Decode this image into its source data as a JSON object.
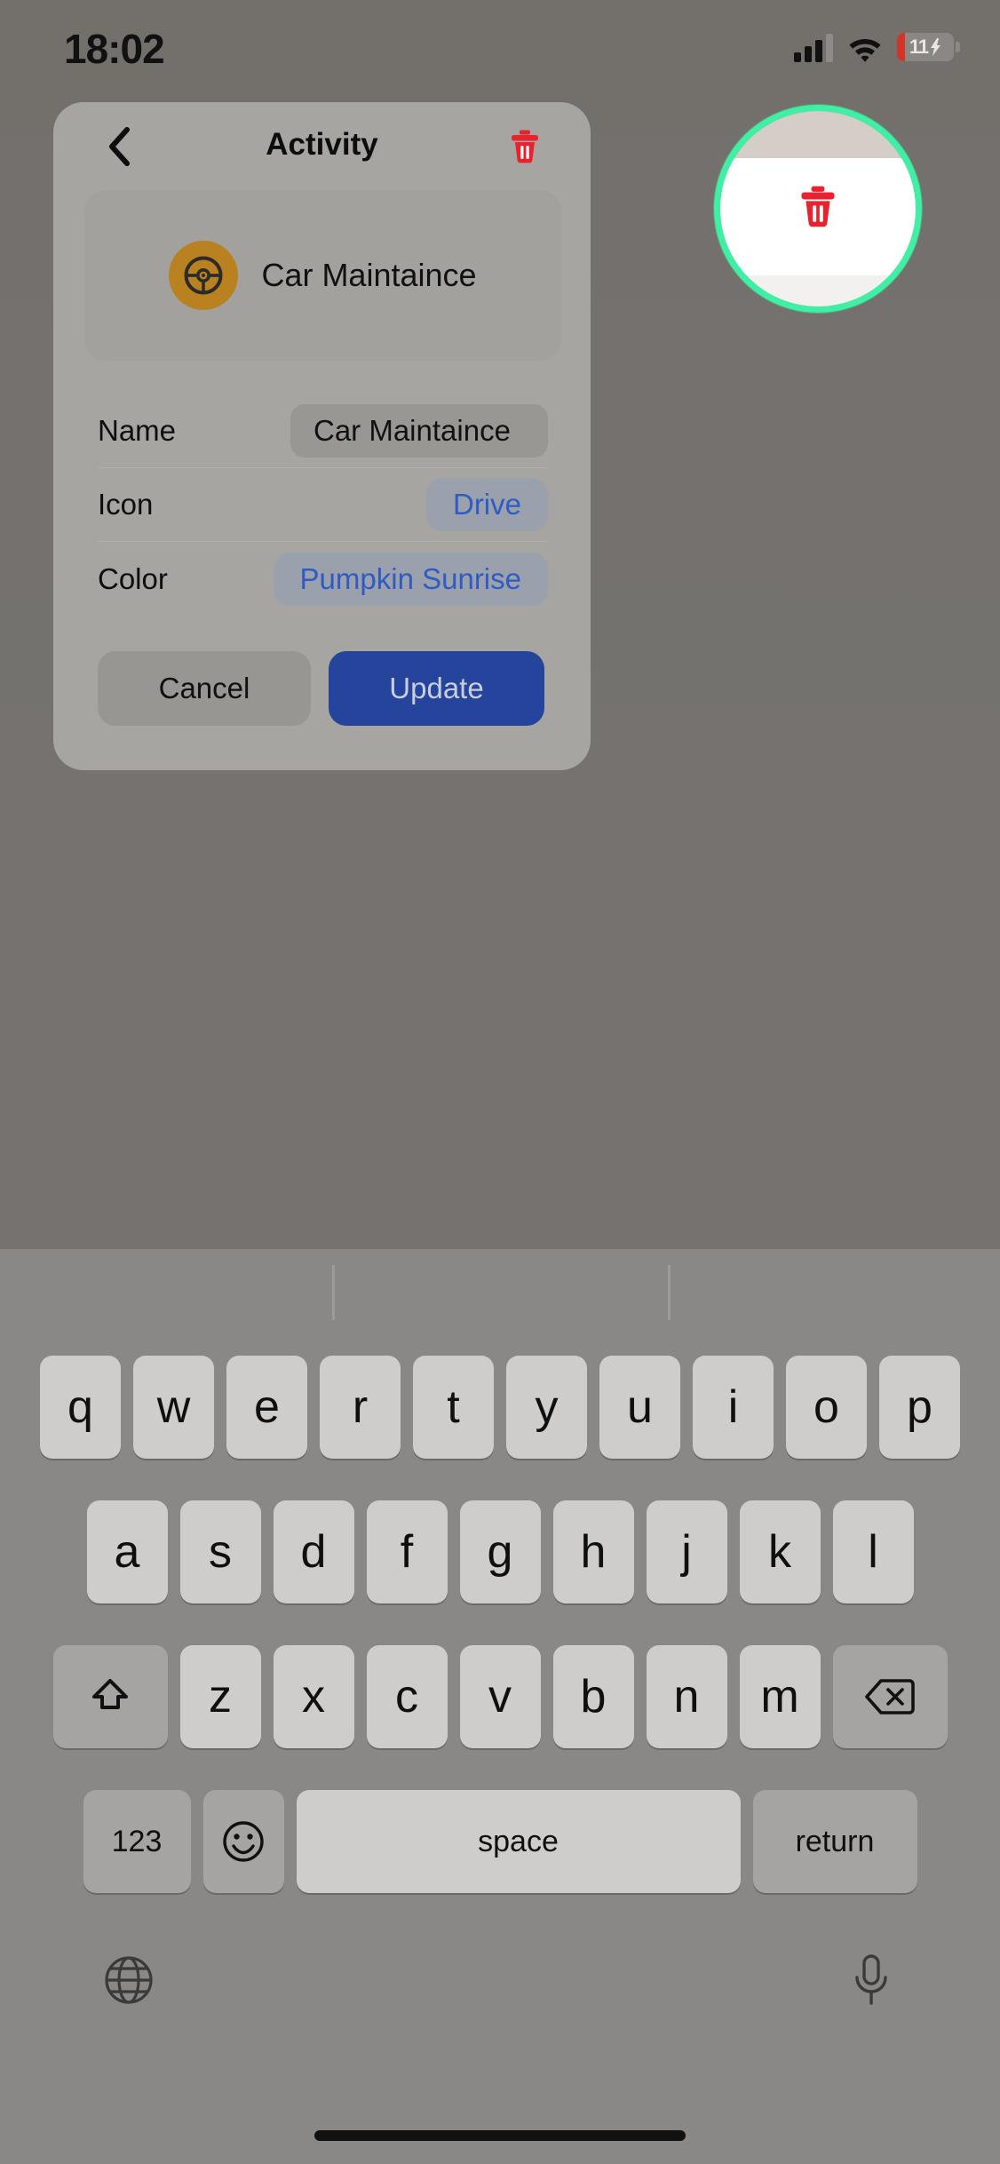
{
  "status_bar": {
    "time": "18:02",
    "battery_percent": "11",
    "cellular_icon": "cellular-bars-icon",
    "wifi_icon": "wifi-icon",
    "battery_icon": "battery-charging-icon"
  },
  "modal": {
    "title": "Activity",
    "back_icon": "chevron-left-icon",
    "delete_icon": "trash-icon",
    "delete_icon_color": "#e8232f",
    "preview": {
      "icon": "steering-wheel-icon",
      "icon_bg_color": "#b9811f",
      "name": "Car Maintaince"
    },
    "fields": [
      {
        "label": "Name",
        "value": "Car Maintaince",
        "kind": "text"
      },
      {
        "label": "Icon",
        "value": "Drive",
        "kind": "pill"
      },
      {
        "label": "Color",
        "value": "Pumpkin Sunrise",
        "kind": "pill"
      }
    ],
    "cancel_label": "Cancel",
    "update_label": "Update",
    "update_color": "#24459b",
    "pill_text_color": "#2f5bc4"
  },
  "highlight": {
    "ring_color": "#3ef0a4",
    "target_icon": "trash-icon"
  },
  "keyboard": {
    "row1": [
      "q",
      "w",
      "e",
      "r",
      "t",
      "y",
      "u",
      "i",
      "o",
      "p"
    ],
    "row2": [
      "a",
      "s",
      "d",
      "f",
      "g",
      "h",
      "j",
      "k",
      "l"
    ],
    "row3": [
      "z",
      "x",
      "c",
      "v",
      "b",
      "n",
      "m"
    ],
    "shift_icon": "shift-up-icon",
    "backspace_icon": "backspace-icon",
    "numbers_label": "123",
    "emoji_icon": "emoji-smiley-icon",
    "space_label": "space",
    "return_label": "return",
    "globe_icon": "globe-icon",
    "mic_icon": "microphone-icon"
  }
}
